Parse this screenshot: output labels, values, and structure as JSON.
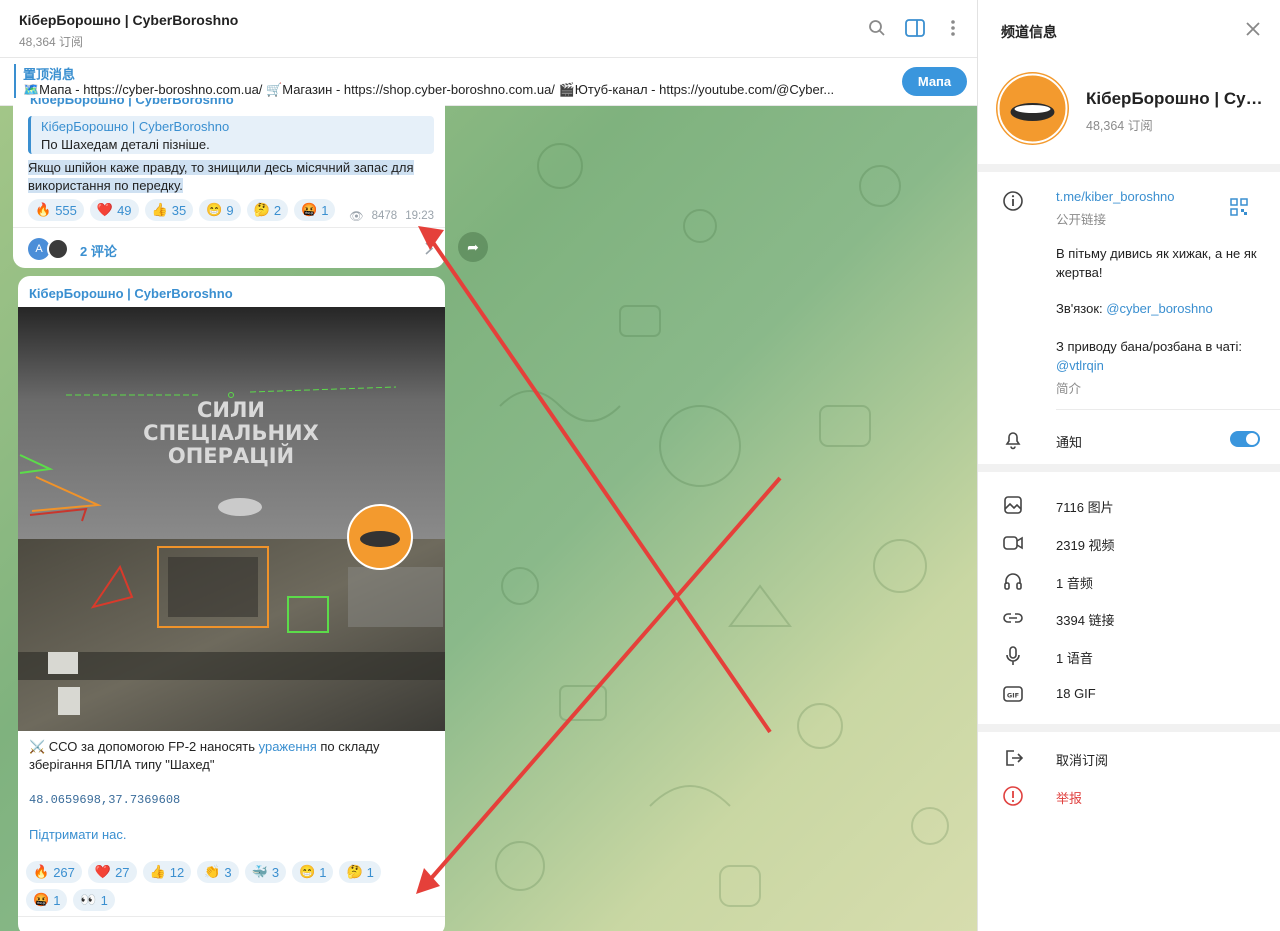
{
  "header": {
    "title": "КіберБорошно | CyberBoroshno",
    "subscribers": "48,364 订阅"
  },
  "pinned": {
    "label": "置顶消息",
    "text": "🗺️Мапа - https://cyber-boroshno.com.ua/ 🛒Магазин - https://shop.cyber-boroshno.com.ua/ 🎬Ютуб-канал - https://youtube.com/@Cyber...",
    "button": "Мапа"
  },
  "msg1": {
    "cut_sender": "КіберБорошно | CyberBoroshno",
    "reply_name": "КіберБорошно | CyberBoroshno",
    "reply_text": "По Шахедам деталі пізніше.",
    "text": "Якщо шпійон каже правду, то знищили десь місячний запас для використання по передку.",
    "reactions": [
      {
        "emoji": "🔥",
        "count": "555"
      },
      {
        "emoji": "❤️",
        "count": "49"
      },
      {
        "emoji": "👍",
        "count": "35"
      },
      {
        "emoji": "😁",
        "count": "9"
      },
      {
        "emoji": "🤔",
        "count": "2"
      },
      {
        "emoji": "🤬",
        "count": "1"
      }
    ],
    "views": "8478",
    "time": "19:23",
    "comments": "2 评论",
    "avatar_letter": "A"
  },
  "msg2": {
    "sender": "КіберБорошно | CyberBoroshno",
    "overlay_text": [
      "СИЛИ",
      "СПЕЦІАЛЬНИХ",
      "ОПЕРАЦІЙ"
    ],
    "caption_pre": "⚔️ ССО за допомогою FP-2 наносять ",
    "caption_link": "ураження",
    "caption_post": " по складу зберігання БПЛА типу \"Шахед\"",
    "coords": "48.0659698,37.7369608",
    "support": "Підтримати нас.",
    "reactions": [
      {
        "emoji": "🔥",
        "count": "267"
      },
      {
        "emoji": "❤️",
        "count": "27"
      },
      {
        "emoji": "👍",
        "count": "12"
      },
      {
        "emoji": "👏",
        "count": "3"
      },
      {
        "emoji": "🐳",
        "count": "3"
      },
      {
        "emoji": "😁",
        "count": "1"
      },
      {
        "emoji": "🤔",
        "count": "1"
      },
      {
        "emoji": "🤬",
        "count": "1"
      },
      {
        "emoji": "👀",
        "count": "1"
      }
    ]
  },
  "sidebar": {
    "title": "频道信息",
    "name": "КіберБорошно | CyberBoroshno",
    "subscribers": "48,364 订阅",
    "link": "t.me/kiber_boroshno",
    "link_label": "公开链接",
    "desc_line1": "В пітьму дивись як хижак, а не як жертва!",
    "contact_label": "Зв'язок: ",
    "contact": "@cyber_boroshno",
    "ban_text": "З приводу бана/розбана в чаті:",
    "ban_contact": "@vtlrqin",
    "desc_label": "简介",
    "notify": "通知",
    "stats": [
      {
        "icon": "image-icon",
        "label": "7116 图片"
      },
      {
        "icon": "video-icon",
        "label": "2319 视频"
      },
      {
        "icon": "headphones-icon",
        "label": "1 音频"
      },
      {
        "icon": "link-icon",
        "label": "3394 链接"
      },
      {
        "icon": "mic-icon",
        "label": "1 语音"
      },
      {
        "icon": "gif-icon",
        "label": "18 GIF"
      }
    ],
    "leave": "取消订阅",
    "report": "举报"
  },
  "colors": {
    "accent": "#3a8fd0",
    "danger": "#e0413f",
    "annotation": "#e5403a"
  }
}
